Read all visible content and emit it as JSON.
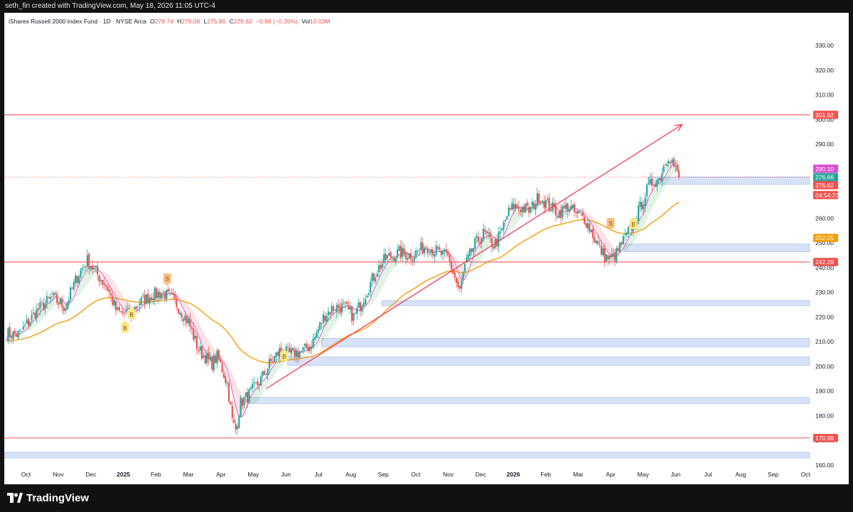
{
  "header": {
    "caption": "seth_fin created with TradingView.com, May 18, 2026 11:05 UTC-4"
  },
  "legend": {
    "symbol": "iShares Russell 2000 Index Fund · 1D · NYSE Arca",
    "o_label": "O",
    "o": "278.74",
    "h_label": "H",
    "h": "279.08",
    "l_label": "L",
    "l": "275.86",
    "c_label": "C",
    "c": "276.62",
    "change": "−0.98 (−0.35%)",
    "vol_label": "Vol",
    "vol": "10.03M"
  },
  "footer": {
    "brand": "TradingView"
  },
  "colors": {
    "up": "#26a69a",
    "down": "#ef5350",
    "ema": "#f59e0b",
    "sma": "#d86bd8",
    "zone": "#c9d8f3",
    "line": "#ef5350",
    "trend": "#ef3d5a"
  },
  "chart_data": {
    "type": "candlestick",
    "ylim": [
      157,
      335
    ],
    "y_ticks": [
      "330.00",
      "320.00",
      "310.00",
      "300.00",
      "290.00",
      "280.00",
      "270.00",
      "260.00",
      "250.00",
      "240.00",
      "230.00",
      "220.00",
      "210.00",
      "200.00",
      "190.00",
      "180.00",
      "170.00",
      "160.00"
    ],
    "x_ticks": [
      {
        "label": "Oct",
        "m": 0
      },
      {
        "label": "Nov",
        "m": 1
      },
      {
        "label": "Dec",
        "m": 2
      },
      {
        "label": "2025",
        "m": 3,
        "bold": true
      },
      {
        "label": "Feb",
        "m": 4
      },
      {
        "label": "Mar",
        "m": 5
      },
      {
        "label": "Apr",
        "m": 6
      },
      {
        "label": "May",
        "m": 7
      },
      {
        "label": "Jun",
        "m": 8
      },
      {
        "label": "Jul",
        "m": 9
      },
      {
        "label": "Aug",
        "m": 10
      },
      {
        "label": "Sep",
        "m": 11
      },
      {
        "label": "Oct",
        "m": 12
      },
      {
        "label": "Nov",
        "m": 13
      },
      {
        "label": "Dec",
        "m": 14
      },
      {
        "label": "2026",
        "m": 15,
        "bold": true
      },
      {
        "label": "Feb",
        "m": 16
      },
      {
        "label": "Mar",
        "m": 17
      },
      {
        "label": "Apr",
        "m": 18
      },
      {
        "label": "May",
        "m": 19
      },
      {
        "label": "Jun",
        "m": 20
      },
      {
        "label": "Jul",
        "m": 21
      },
      {
        "label": "Aug",
        "m": 22
      },
      {
        "label": "Sep",
        "m": 23
      },
      {
        "label": "Oct",
        "m": 24
      }
    ],
    "close_path": [
      [
        -0.2,
        213
      ],
      [
        0.3,
        222
      ],
      [
        0.8,
        228
      ],
      [
        1.2,
        224
      ],
      [
        1.6,
        237
      ],
      [
        1.9,
        243
      ],
      [
        2.1,
        239
      ],
      [
        2.5,
        232
      ],
      [
        2.8,
        222
      ],
      [
        3.2,
        221
      ],
      [
        3.5,
        226
      ],
      [
        3.9,
        229
      ],
      [
        4.2,
        230
      ],
      [
        4.4,
        228
      ],
      [
        4.6,
        226
      ],
      [
        5.0,
        218
      ],
      [
        5.3,
        207
      ],
      [
        5.7,
        201
      ],
      [
        5.9,
        204
      ],
      [
        6.2,
        193
      ],
      [
        6.35,
        178
      ],
      [
        6.45,
        174
      ],
      [
        6.6,
        185
      ],
      [
        6.9,
        189
      ],
      [
        7.2,
        194
      ],
      [
        7.5,
        201
      ],
      [
        7.8,
        206
      ],
      [
        8.1,
        205
      ],
      [
        8.5,
        206
      ],
      [
        8.8,
        209
      ],
      [
        9.2,
        221
      ],
      [
        9.5,
        224
      ],
      [
        9.8,
        224
      ],
      [
        10.1,
        220
      ],
      [
        10.4,
        228
      ],
      [
        10.8,
        239
      ],
      [
        11.1,
        244
      ],
      [
        11.5,
        246
      ],
      [
        11.9,
        245
      ],
      [
        12.3,
        249
      ],
      [
        12.7,
        246
      ],
      [
        13.0,
        244
      ],
      [
        13.2,
        236
      ],
      [
        13.35,
        230
      ],
      [
        13.5,
        240
      ],
      [
        13.8,
        249
      ],
      [
        14.1,
        254
      ],
      [
        14.4,
        249
      ],
      [
        14.6,
        253
      ],
      [
        14.8,
        261
      ],
      [
        15.0,
        265
      ],
      [
        15.3,
        264
      ],
      [
        15.5,
        263
      ],
      [
        15.8,
        269
      ],
      [
        16.1,
        265
      ],
      [
        16.4,
        262
      ],
      [
        16.7,
        265
      ],
      [
        16.9,
        262
      ],
      [
        17.2,
        260
      ],
      [
        17.4,
        255
      ],
      [
        17.6,
        249
      ],
      [
        17.8,
        245
      ],
      [
        18.0,
        243
      ],
      [
        18.2,
        246
      ],
      [
        18.35,
        250
      ],
      [
        18.5,
        253
      ],
      [
        18.7,
        258
      ],
      [
        18.9,
        264
      ],
      [
        19.1,
        271
      ],
      [
        19.3,
        275
      ],
      [
        19.5,
        276
      ],
      [
        19.65,
        282
      ],
      [
        19.8,
        286
      ],
      [
        19.95,
        281
      ],
      [
        20.1,
        276.6
      ]
    ],
    "overlays": {
      "horizontal_lines": [
        301.92,
        242.28,
        170.98
      ],
      "dotted_line": 276.62,
      "zones": [
        [
          273.8,
          276.8
        ],
        [
          246.4,
          249.6
        ],
        [
          224.6,
          226.6
        ],
        [
          207.9,
          211.4
        ],
        [
          200.4,
          203.8
        ],
        [
          184.9,
          187.4
        ],
        [
          162.8,
          165.2
        ]
      ],
      "trend_line": {
        "from": [
          7.4,
          191
        ],
        "to": [
          20.2,
          298
        ]
      },
      "sma": "fast moving average",
      "ema": "slow moving average"
    },
    "price_labels": [
      {
        "text": "301.92",
        "value": 301.92,
        "bg": "#ef5350"
      },
      {
        "text": "280.10",
        "value": 280.1,
        "bg": "#d84bd1"
      },
      {
        "text": "276.66",
        "value": 276.66,
        "bg": "#26a69a"
      },
      {
        "text": "276.62",
        "value": 273.4,
        "bg": "#ef5350"
      },
      {
        "text": "04:54:27",
        "value": 269.4,
        "bg": "#ef5350"
      },
      {
        "text": "252.05",
        "value": 252.05,
        "bg": "#f59e0b"
      },
      {
        "text": "242.28",
        "value": 242.28,
        "bg": "#ef5350"
      },
      {
        "text": "170.98",
        "value": 170.98,
        "bg": "#ef5350"
      }
    ],
    "signals": [
      {
        "text": "B",
        "x": 3.25,
        "y": 221,
        "dir": "up"
      },
      {
        "text": "B",
        "x": 3.05,
        "y": 215.5,
        "dir": "up"
      },
      {
        "text": "S",
        "x": 4.35,
        "y": 235.5,
        "dir": "down"
      },
      {
        "text": "B",
        "x": 7.95,
        "y": 204,
        "dir": "up"
      },
      {
        "text": "S",
        "x": 18.0,
        "y": 258,
        "dir": "down"
      },
      {
        "text": "B",
        "x": 18.7,
        "y": 257.5,
        "dir": "up"
      }
    ]
  }
}
